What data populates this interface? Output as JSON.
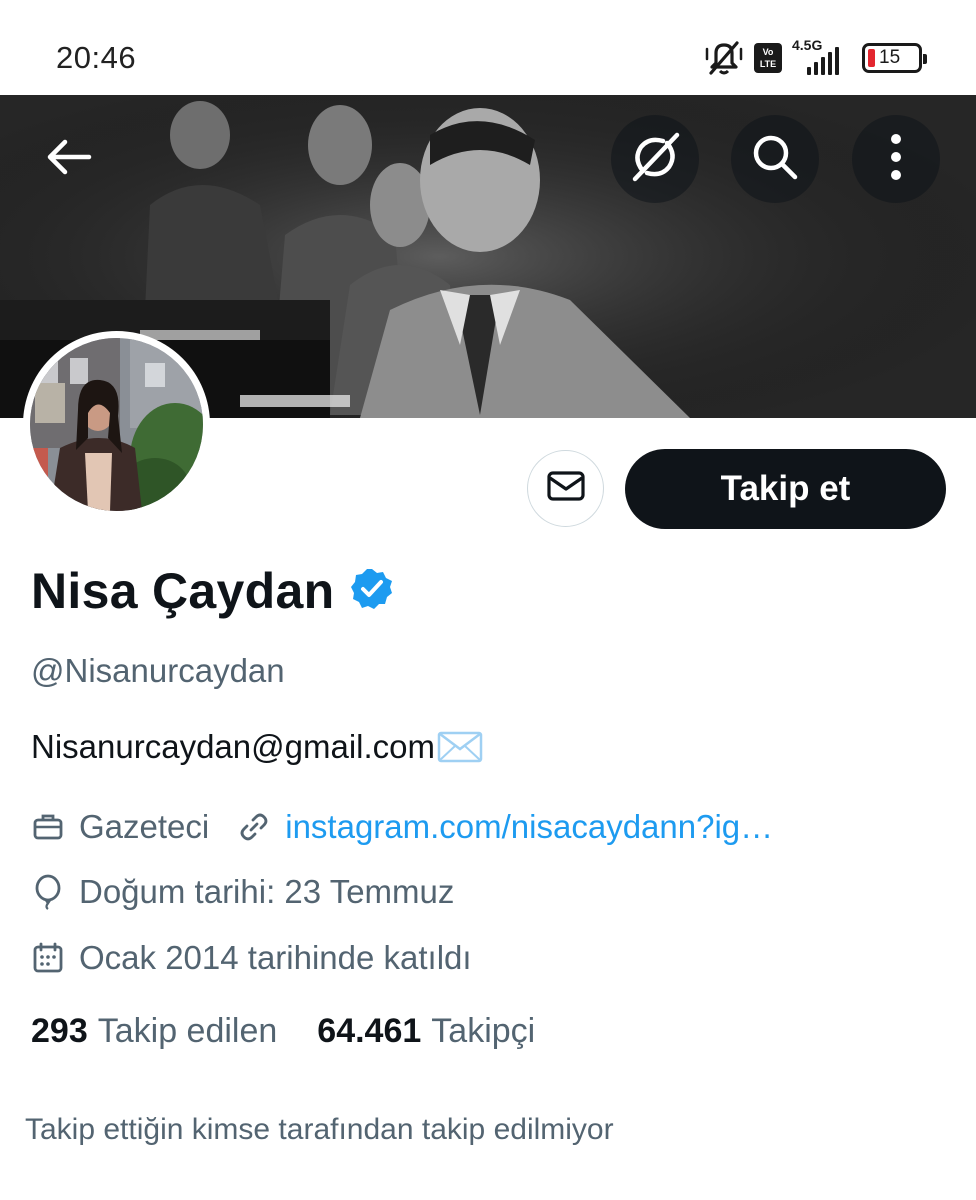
{
  "status_bar": {
    "time": "20:46",
    "volte_label_top": "Vo",
    "volte_label_bottom": "LTE",
    "network_label": "4.5G",
    "battery_level": "15",
    "icons": [
      "mute-icon",
      "volte-icon",
      "signal-icon",
      "battery-icon"
    ]
  },
  "header": {
    "icons": [
      "back-arrow-icon",
      "grok-icon",
      "search-icon",
      "more-icon"
    ]
  },
  "actions": {
    "message_icon": "mail-icon",
    "follow_label": "Takip et"
  },
  "profile": {
    "name": "Nisa Çaydan",
    "verified_icon": "verified-badge-icon",
    "verified_color": "#1d9bf0",
    "handle": "@Nisanurcaydan",
    "bio": "Nisanurcaydan@gmail.com",
    "bio_emoji": "envelope-emoji",
    "profession_icon": "briefcase-icon",
    "profession": "Gazeteci",
    "link_icon": "link-icon",
    "link": "instagram.com/nisacaydann?ig…",
    "birth_icon": "balloon-icon",
    "birth": "Doğum tarihi: 23 Temmuz",
    "joined_icon": "calendar-icon",
    "joined": "Ocak 2014 tarihinde katıldı"
  },
  "stats": {
    "following_count": "293",
    "following_label": "Takip edilen",
    "followers_count": "64.461",
    "followers_label": "Takipçi"
  },
  "notice": "Takip ettiğin kimse tarafından takip edilmiyor",
  "colors": {
    "text_primary": "#0f1419",
    "text_secondary": "#536471",
    "link": "#1d9bf0",
    "button_dark": "#0f1419"
  }
}
